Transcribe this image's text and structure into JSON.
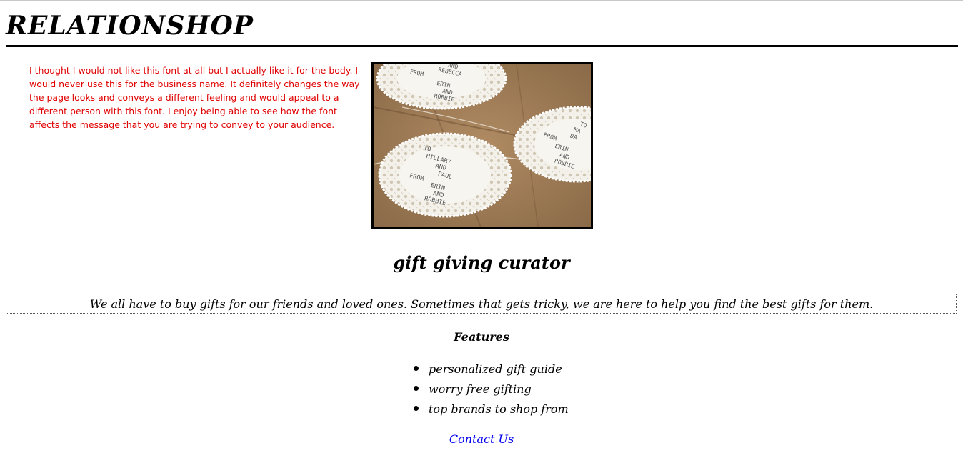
{
  "header": {
    "title": "RELATIONSHOP"
  },
  "intro": {
    "text": "I thought I would not like this font at all but I actually like it for the body. I would never use this for the business name. It definitely changes the way the page looks and conveys a different feeling and would appeal to a different person with this font. I enjoy being able to see how the font affects the message that you are trying to convey to your audience.",
    "color": "#e00000"
  },
  "photo": {
    "tags": [
      {
        "lines": [
          "AND",
          "REBECCA",
          "FROM",
          "ERIN",
          "AND",
          "ROBBIE"
        ]
      },
      {
        "lines": [
          "TO",
          "HILLARY",
          "AND",
          "PAUL",
          "FROM",
          "ERIN",
          "AND",
          "ROBBIE"
        ]
      },
      {
        "lines": [
          "TO",
          "MA",
          "DA",
          "FROM",
          "ERIN",
          "AND",
          "ROBBIE"
        ]
      }
    ]
  },
  "tagline": "gift giving curator",
  "description": "We all have to buy gifts for our friends and loved ones. Sometimes that gets tricky, we are here to help you find the best gifts for them.",
  "features": {
    "heading": "Features",
    "items": [
      "personalized gift guide",
      "worry free gifting",
      "top brands to shop from"
    ]
  },
  "contact": {
    "label": "Contact Us",
    "color": "#0000ee"
  }
}
